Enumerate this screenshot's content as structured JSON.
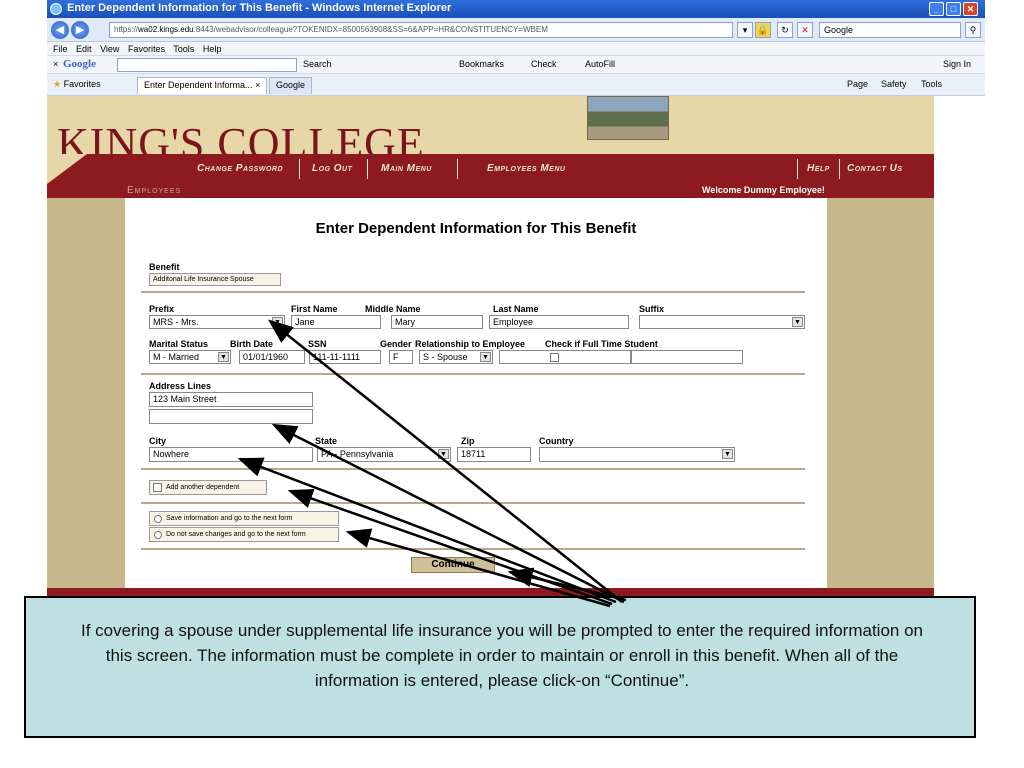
{
  "browser": {
    "title": "Enter Dependent Information for This Benefit - Windows Internet Explorer",
    "url_scheme": "https://",
    "url_host": "wa02.kings.edu",
    "url_path": ":8443/webadvisor/colleague?TOKENIDX=8500563908&SS=6&APP=HR&CONSTITUENCY=WBEM",
    "search_engine": "Google",
    "menu": [
      "File",
      "Edit",
      "View",
      "Favorites",
      "Tools",
      "Help"
    ],
    "google_toolbar": {
      "close": "×",
      "logo": "Google",
      "search": "Search",
      "bookmarks": "Bookmarks",
      "check": "Check",
      "autofill": "AutoFill",
      "sign_in": "Sign In"
    },
    "favorites_label": "Favorites",
    "tabs": [
      "Enter Dependent Informa...",
      "Google"
    ],
    "tab_close": "×",
    "command_bar": [
      "Page",
      "Safety",
      "Tools"
    ]
  },
  "site": {
    "logo": "KING'S COLLEGE",
    "nav": [
      "Change Password",
      "Log Out",
      "Main Menu",
      "Employees Menu",
      "Help",
      "Contact Us"
    ],
    "section": "Employees",
    "welcome": "Welcome Dummy Employee!"
  },
  "form": {
    "title": "Enter Dependent Information for This Benefit",
    "benefit_label": "Benefit",
    "benefit_value": "Additonal Life Insurance Spouse",
    "labels": {
      "prefix": "Prefix",
      "first_name": "First Name",
      "middle_name": "Middle Name",
      "last_name": "Last Name",
      "suffix": "Suffix",
      "marital_status": "Marital Status",
      "birth_date": "Birth Date",
      "ssn": "SSN",
      "gender": "Gender",
      "relationship": "Relationship to Employee",
      "full_time_student": "Check if Full Time Student",
      "address_lines": "Address Lines",
      "city": "City",
      "state": "State",
      "zip": "Zip",
      "country": "Country"
    },
    "values": {
      "prefix": "MRS - Mrs.",
      "first_name": "Jane",
      "middle_name": "Mary",
      "last_name": "Employee",
      "suffix": "",
      "marital_status": "M - Married",
      "birth_date": "01/01/1960",
      "ssn": "111-11-1111",
      "gender": "F",
      "relationship": "S - Spouse",
      "address_line_1": "123 Main Street",
      "address_line_2": "",
      "city": "Nowhere",
      "state": "PA - Pennsylvania",
      "zip": "18711",
      "country": ""
    },
    "add_dependent": "Add another dependent",
    "save_option": "Save information and go to the next form",
    "nosave_option": "Do not save changes and go to the next form",
    "continue": "Continue"
  },
  "callout": {
    "text": "If covering a spouse under supplemental life insurance you will be prompted to enter the required information on this screen.  The information must be complete in order to maintain or enroll in this benefit.  When all of the information is entered, please click-on “Continue”."
  }
}
